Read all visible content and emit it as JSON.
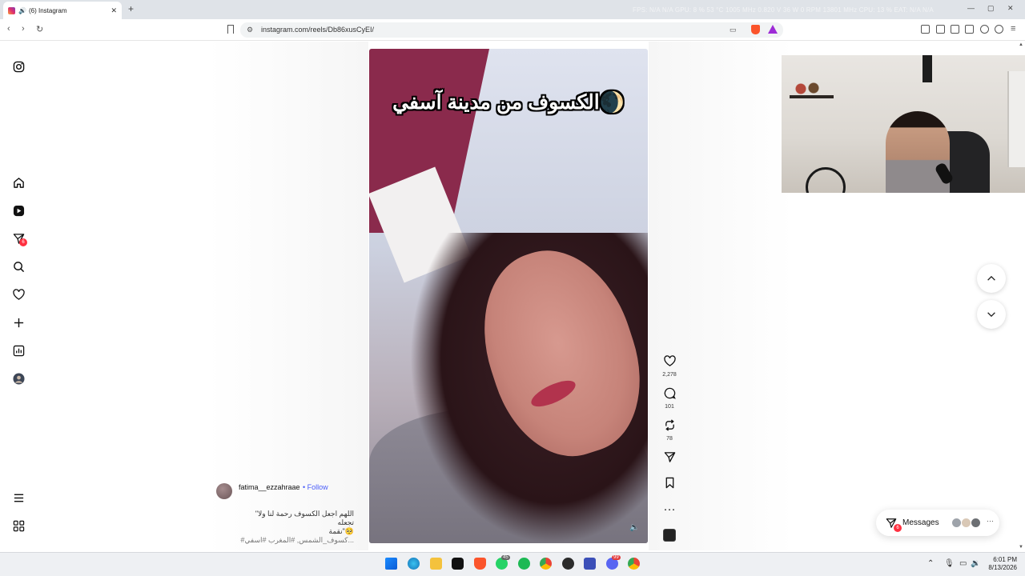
{
  "browser": {
    "tab_title": "(6) Instagram",
    "new_tab": "+",
    "hud_text": "FPS: N/A  N/A    GPU: 8 %  53 °C  1005 MHz  0.820 V  36 W  0 RPM  13801 MHz    CPU: 13 %    EAT: N/A  N/A",
    "url": "instagram.com/reels/Db86xusCyEI/",
    "back": "‹",
    "forward": "›",
    "reload": "↻",
    "min": "—",
    "max": "▢",
    "close": "✕",
    "tab_close": "✕"
  },
  "sidebar": {
    "badge_count": "6",
    "icons": [
      "instagram-icon",
      "home-icon",
      "reels-icon",
      "messages-icon",
      "search-icon",
      "heart-icon",
      "create-icon",
      "insights-icon",
      "profile-avatar",
      "menu-icon",
      "apps-icon"
    ]
  },
  "reel": {
    "overlay_text": "الكسوف من مدينة آسفي🌒",
    "author": "fatima__ezzahraae",
    "follow": "• Follow",
    "caption_line1": "\"اللهم اجعل الكسوف رحمة لنا ولا تجعله",
    "caption_line2": "نقمة\"🥺",
    "caption_line3": "#كسوف_الشمس, #المغرب #اسفي...",
    "likes": "2,278",
    "comments": "101",
    "reposts": "78"
  },
  "messages": {
    "label": "Messages",
    "badge": "6",
    "more": "···"
  },
  "taskbar": {
    "apps": [
      "windows-start",
      "edge",
      "file-explorer",
      "tiktok",
      "brave",
      "whatsapp",
      "spotify",
      "chrome",
      "obs",
      "visual-studio",
      "discord",
      "chrome-2"
    ],
    "whatsapp_count": "45",
    "discord_count": "99",
    "time": "6:01 PM",
    "date": "8/13/2026"
  },
  "colors": {
    "accent_blue": "#4a5df9",
    "badge_red": "#ff3040",
    "brave_orange": "#fb542b"
  }
}
